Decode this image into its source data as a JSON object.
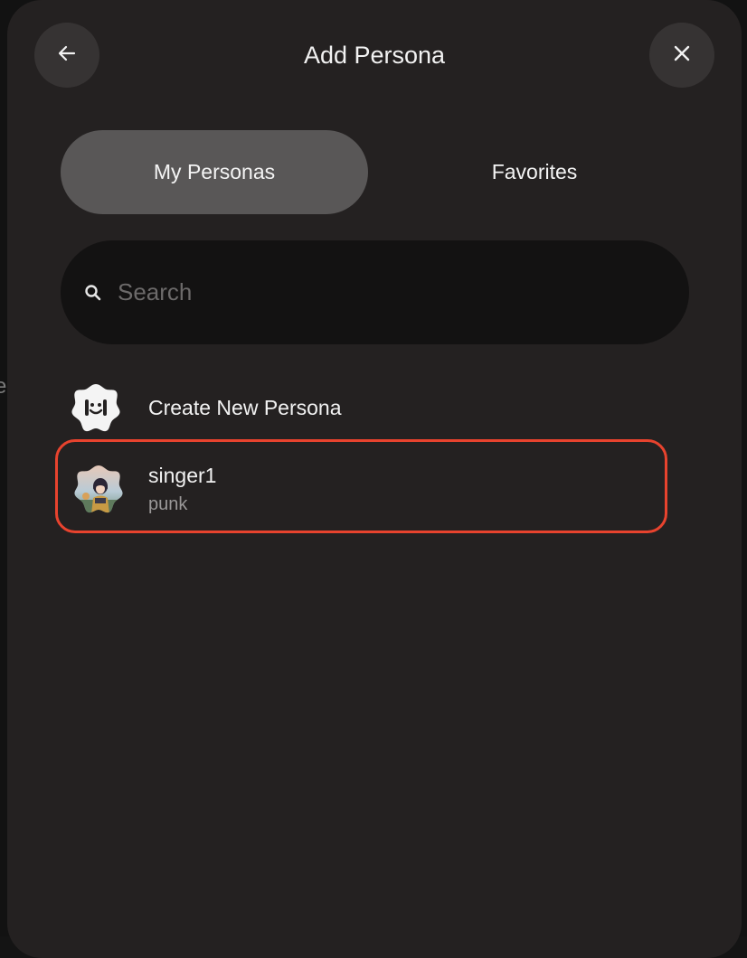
{
  "header": {
    "title": "Add Persona",
    "back_icon": "arrow-left-icon",
    "close_icon": "close-icon"
  },
  "tabs": [
    {
      "label": "My Personas",
      "selected": true
    },
    {
      "label": "Favorites",
      "selected": false
    }
  ],
  "search": {
    "placeholder": "Search",
    "value": "",
    "icon": "search-icon"
  },
  "create": {
    "label": "Create New Persona",
    "icon": "face-badge-icon"
  },
  "personas": [
    {
      "name": "singer1",
      "description": "punk",
      "highlight_color": "#e8432e"
    }
  ],
  "colors": {
    "modal_bg": "#242121",
    "tab_selected_bg": "#595757",
    "search_bg": "#131212",
    "highlight": "#e8432e"
  }
}
